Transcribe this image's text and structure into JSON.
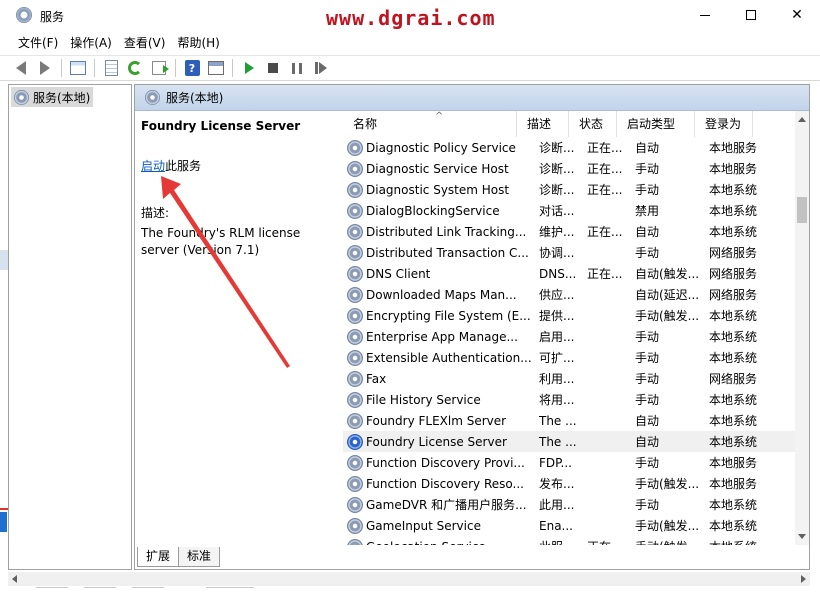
{
  "window": {
    "title": "服务",
    "watermark": "www.dgrai.com"
  },
  "menu": [
    "文件(F)",
    "操作(A)",
    "查看(V)",
    "帮助(H)"
  ],
  "toolbar": {
    "help_glyph": "?"
  },
  "tree": {
    "root_label": "服务(本地)"
  },
  "main": {
    "header_label": "服务(本地)",
    "selected_service_title": "Foundry License Server",
    "start_link": "启动",
    "start_suffix": "此服务",
    "description_label": "描述:",
    "description_text": "The Foundry's RLM license server (Version 7.1)"
  },
  "list": {
    "columns": [
      "名称",
      "描述",
      "状态",
      "启动类型",
      "登录为"
    ],
    "rows": [
      {
        "name": "Diagnostic Policy Service",
        "desc": "诊断...",
        "status": "正在...",
        "startup": "自动",
        "logon": "本地服务"
      },
      {
        "name": "Diagnostic Service Host",
        "desc": "诊断...",
        "status": "正在...",
        "startup": "手动",
        "logon": "本地服务"
      },
      {
        "name": "Diagnostic System Host",
        "desc": "诊断...",
        "status": "正在...",
        "startup": "手动",
        "logon": "本地系统"
      },
      {
        "name": "DialogBlockingService",
        "desc": "对话...",
        "status": "",
        "startup": "禁用",
        "logon": "本地系统"
      },
      {
        "name": "Distributed Link Tracking...",
        "desc": "维护...",
        "status": "正在...",
        "startup": "自动",
        "logon": "本地系统"
      },
      {
        "name": "Distributed Transaction C...",
        "desc": "协调...",
        "status": "",
        "startup": "手动",
        "logon": "网络服务"
      },
      {
        "name": "DNS Client",
        "desc": "DNS...",
        "status": "正在...",
        "startup": "自动(触发...",
        "logon": "网络服务"
      },
      {
        "name": "Downloaded Maps Man...",
        "desc": "供应...",
        "status": "",
        "startup": "自动(延迟...",
        "logon": "网络服务"
      },
      {
        "name": "Encrypting File System (E...",
        "desc": "提供...",
        "status": "",
        "startup": "手动(触发...",
        "logon": "本地系统"
      },
      {
        "name": "Enterprise App Manage...",
        "desc": "启用...",
        "status": "",
        "startup": "手动",
        "logon": "本地系统"
      },
      {
        "name": "Extensible Authentication...",
        "desc": "可扩...",
        "status": "",
        "startup": "手动",
        "logon": "本地系统"
      },
      {
        "name": "Fax",
        "desc": "利用...",
        "status": "",
        "startup": "手动",
        "logon": "网络服务"
      },
      {
        "name": "File History Service",
        "desc": "将用...",
        "status": "",
        "startup": "手动",
        "logon": "本地系统"
      },
      {
        "name": "Foundry FLEXlm Server",
        "desc": "The ...",
        "status": "",
        "startup": "自动",
        "logon": "本地系统"
      },
      {
        "name": "Foundry License Server",
        "desc": "The ...",
        "status": "",
        "startup": "自动",
        "logon": "本地系统"
      },
      {
        "name": "Function Discovery Provi...",
        "desc": "FDP...",
        "status": "",
        "startup": "手动",
        "logon": "本地服务"
      },
      {
        "name": "Function Discovery Reso...",
        "desc": "发布...",
        "status": "",
        "startup": "手动(触发...",
        "logon": "本地服务"
      },
      {
        "name": "GameDVR 和广播用户服务...",
        "desc": "此用...",
        "status": "",
        "startup": "手动",
        "logon": "本地系统"
      },
      {
        "name": "GameInput Service",
        "desc": "Ena...",
        "status": "",
        "startup": "手动(触发...",
        "logon": "本地系统"
      },
      {
        "name": "Geolocation Service",
        "desc": "此服...",
        "status": "正在...",
        "startup": "手动(触发...",
        "logon": "本地系统"
      }
    ],
    "selected_index": 14
  },
  "tabs": [
    "扩展",
    "标准"
  ],
  "colors": {
    "watermark": "#c1121f",
    "arrow": "#e53935",
    "link": "#0b5cc2",
    "header_blue": "#c2d4ea"
  }
}
